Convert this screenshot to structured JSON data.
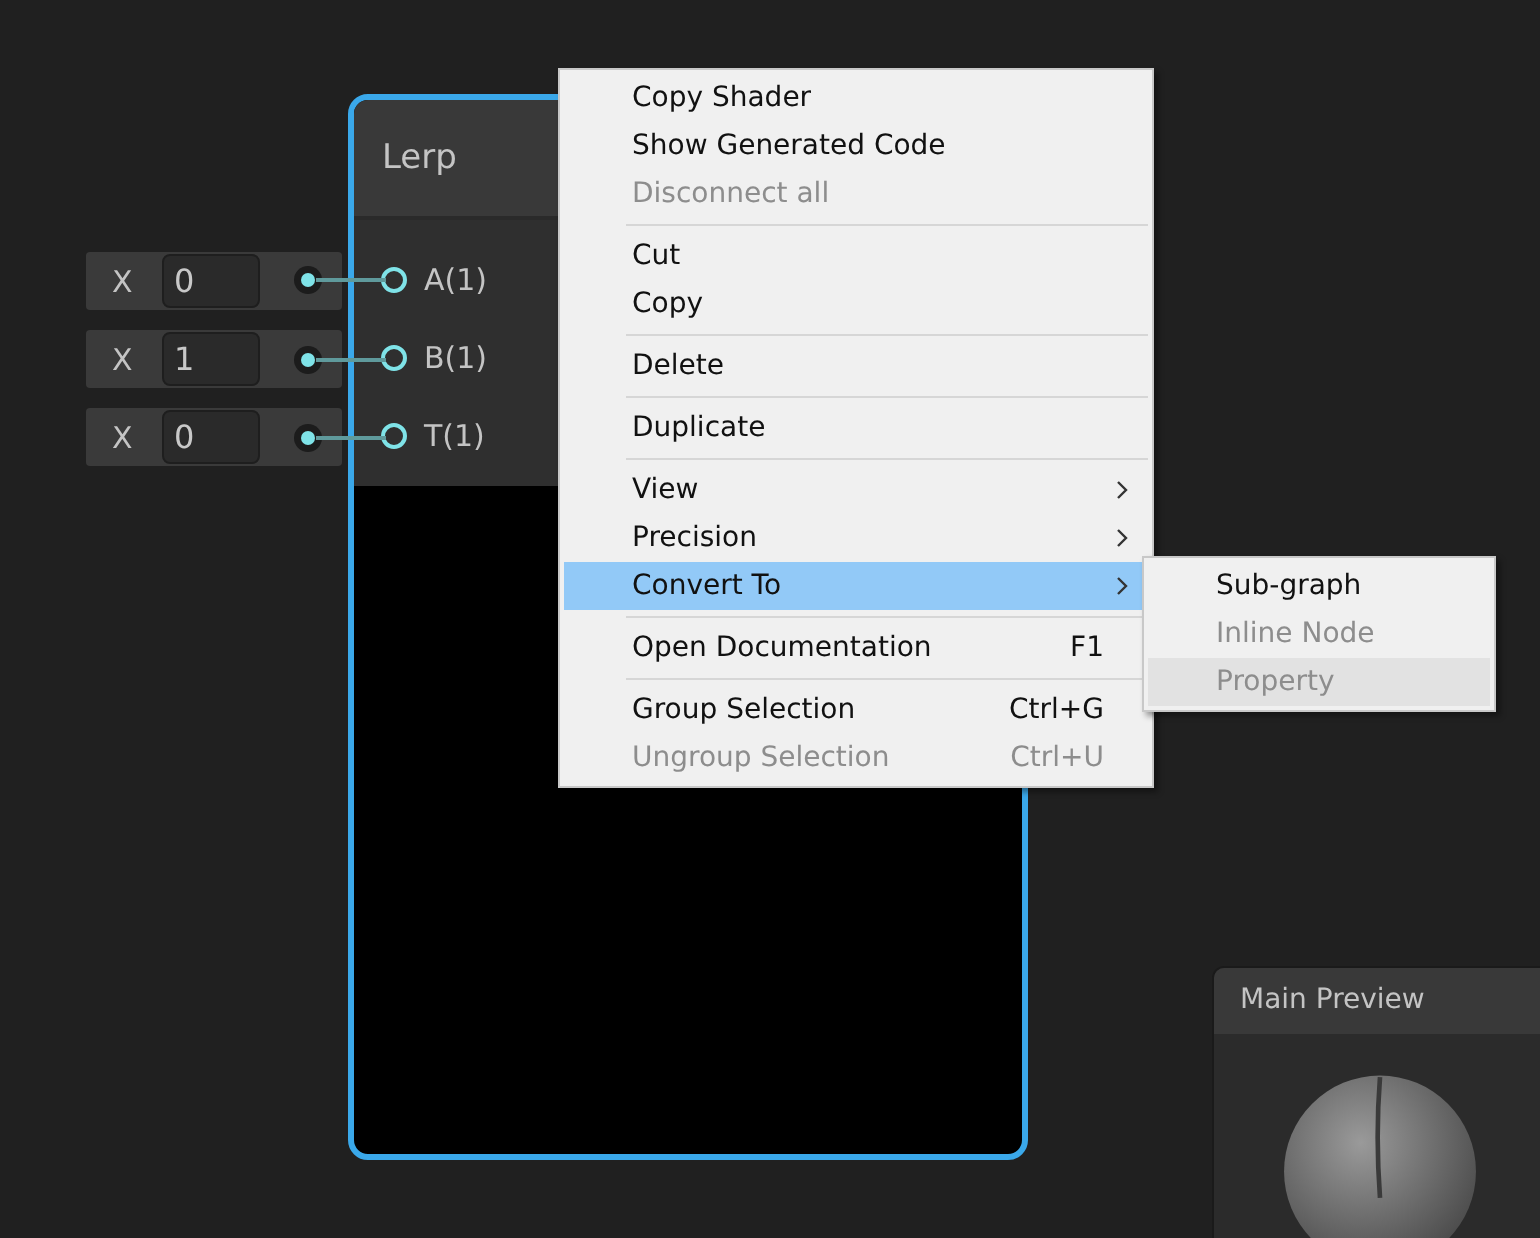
{
  "node": {
    "title": "Lerp",
    "inputs": [
      {
        "axis": "X",
        "value": "0",
        "port": "A(1)"
      },
      {
        "axis": "X",
        "value": "1",
        "port": "B(1)"
      },
      {
        "axis": "X",
        "value": "0",
        "port": "T(1)"
      }
    ]
  },
  "context_menu": {
    "groups": [
      [
        {
          "label": "Copy Shader",
          "disabled": false,
          "selected": false,
          "has_submenu": false
        },
        {
          "label": "Show Generated Code",
          "disabled": false,
          "selected": false,
          "has_submenu": false
        },
        {
          "label": "Disconnect all",
          "disabled": true,
          "selected": false,
          "has_submenu": false
        }
      ],
      [
        {
          "label": "Cut",
          "disabled": false,
          "selected": false,
          "has_submenu": false
        },
        {
          "label": "Copy",
          "disabled": false,
          "selected": false,
          "has_submenu": false
        }
      ],
      [
        {
          "label": "Delete",
          "disabled": false,
          "selected": false,
          "has_submenu": false
        }
      ],
      [
        {
          "label": "Duplicate",
          "disabled": false,
          "selected": false,
          "has_submenu": false
        }
      ],
      [
        {
          "label": "View",
          "disabled": false,
          "selected": false,
          "has_submenu": true
        },
        {
          "label": "Precision",
          "disabled": false,
          "selected": false,
          "has_submenu": true
        },
        {
          "label": "Convert To",
          "disabled": false,
          "selected": true,
          "has_submenu": true
        }
      ],
      [
        {
          "label": "Open Documentation",
          "shortcut": "F1",
          "disabled": false,
          "selected": false,
          "has_submenu": false
        }
      ],
      [
        {
          "label": "Group Selection",
          "shortcut": "Ctrl+G",
          "disabled": false,
          "selected": false,
          "has_submenu": false
        },
        {
          "label": "Ungroup Selection",
          "shortcut": "Ctrl+U",
          "disabled": true,
          "selected": false,
          "has_submenu": false
        }
      ]
    ]
  },
  "submenu": {
    "items": [
      {
        "label": "Sub-graph",
        "disabled": false,
        "selected": false
      },
      {
        "label": "Inline Node",
        "disabled": true,
        "selected": false
      },
      {
        "label": "Property",
        "disabled": true,
        "selected": true
      }
    ]
  },
  "preview": {
    "title": "Main Preview"
  }
}
